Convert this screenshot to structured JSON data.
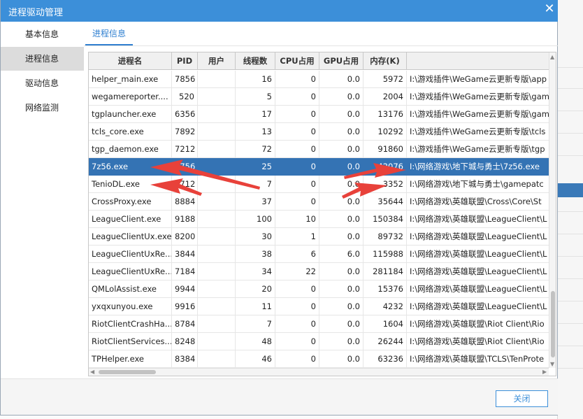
{
  "window": {
    "title": "进程驱动管理",
    "close_glyph": "✕"
  },
  "sidebar": {
    "items": [
      {
        "label": "基本信息",
        "active": false
      },
      {
        "label": "进程信息",
        "active": true
      },
      {
        "label": "驱动信息",
        "active": false
      },
      {
        "label": "网络监测",
        "active": false
      }
    ]
  },
  "tabs": [
    {
      "label": "进程信息"
    }
  ],
  "table": {
    "columns": [
      "进程名",
      "PID",
      "用户",
      "线程数",
      "CPU占用",
      "GPU占用",
      "内存(K)",
      ""
    ],
    "rows": [
      {
        "name": "helper_main.exe",
        "pid": "7856",
        "user": "",
        "threads": "16",
        "cpu": "0",
        "gpu": "0.0",
        "mem": "5972",
        "path": "I:\\游戏插件\\WeGame云更新专版\\app",
        "selected": false
      },
      {
        "name": "wegamereporter....",
        "pid": "520",
        "user": "",
        "threads": "5",
        "cpu": "0",
        "gpu": "0.0",
        "mem": "2004",
        "path": "I:\\游戏插件\\WeGame云更新专版\\gam",
        "selected": false
      },
      {
        "name": "tgplauncher.exe",
        "pid": "6356",
        "user": "",
        "threads": "17",
        "cpu": "0",
        "gpu": "0.0",
        "mem": "13176",
        "path": "I:\\游戏插件\\WeGame云更新专版\\gam",
        "selected": false
      },
      {
        "name": "tcls_core.exe",
        "pid": "7892",
        "user": "",
        "threads": "13",
        "cpu": "0",
        "gpu": "0.0",
        "mem": "10292",
        "path": "I:\\游戏插件\\WeGame云更新专版\\tcls",
        "selected": false
      },
      {
        "name": "tgp_daemon.exe",
        "pid": "7212",
        "user": "",
        "threads": "72",
        "cpu": "0",
        "gpu": "0.0",
        "mem": "91860",
        "path": "I:\\游戏插件\\WeGame云更新专版\\tgp",
        "selected": false
      },
      {
        "name": "7z56.exe",
        "pid": "1756",
        "user": "",
        "threads": "25",
        "cpu": "0",
        "gpu": "0.0",
        "mem": "42076",
        "path": "I:\\网络游戏\\地下城与勇士\\7z56.exe",
        "selected": true
      },
      {
        "name": "TenioDL.exe",
        "pid": "2712",
        "user": "",
        "threads": "7",
        "cpu": "0",
        "gpu": "0.0",
        "mem": "3352",
        "path": "I:\\网络游戏\\地下城与勇士\\gamepatc",
        "selected": false
      },
      {
        "name": "CrossProxy.exe",
        "pid": "8884",
        "user": "",
        "threads": "37",
        "cpu": "0",
        "gpu": "0.0",
        "mem": "35644",
        "path": "I:\\网络游戏\\英雄联盟\\Cross\\Core\\St",
        "selected": false
      },
      {
        "name": "LeagueClient.exe",
        "pid": "9188",
        "user": "",
        "threads": "100",
        "cpu": "10",
        "gpu": "0.0",
        "mem": "150384",
        "path": "I:\\网络游戏\\英雄联盟\\LeagueClient\\L",
        "selected": false
      },
      {
        "name": "LeagueClientUx.exe",
        "pid": "8200",
        "user": "",
        "threads": "30",
        "cpu": "1",
        "gpu": "0.0",
        "mem": "89732",
        "path": "I:\\网络游戏\\英雄联盟\\LeagueClient\\L",
        "selected": false
      },
      {
        "name": "LeagueClientUxRe...",
        "pid": "3844",
        "user": "",
        "threads": "38",
        "cpu": "6",
        "gpu": "6.0",
        "mem": "115988",
        "path": "I:\\网络游戏\\英雄联盟\\LeagueClient\\L",
        "selected": false
      },
      {
        "name": "LeagueClientUxRe...",
        "pid": "7184",
        "user": "",
        "threads": "34",
        "cpu": "22",
        "gpu": "0.0",
        "mem": "281184",
        "path": "I:\\网络游戏\\英雄联盟\\LeagueClient\\L",
        "selected": false
      },
      {
        "name": "QMLolAssist.exe",
        "pid": "9944",
        "user": "",
        "threads": "20",
        "cpu": "0",
        "gpu": "0.0",
        "mem": "15376",
        "path": "I:\\网络游戏\\英雄联盟\\LeagueClient\\L",
        "selected": false
      },
      {
        "name": "yxqxunyou.exe",
        "pid": "9916",
        "user": "",
        "threads": "11",
        "cpu": "0",
        "gpu": "0.0",
        "mem": "4232",
        "path": "I:\\网络游戏\\英雄联盟\\LeagueClient\\L",
        "selected": false
      },
      {
        "name": "RiotClientCrashHa...",
        "pid": "8784",
        "user": "",
        "threads": "7",
        "cpu": "0",
        "gpu": "0.0",
        "mem": "1604",
        "path": "I:\\网络游戏\\英雄联盟\\Riot Client\\Rio",
        "selected": false
      },
      {
        "name": "RiotClientServices....",
        "pid": "8248",
        "user": "",
        "threads": "48",
        "cpu": "0",
        "gpu": "0.0",
        "mem": "26244",
        "path": "I:\\网络游戏\\英雄联盟\\Riot Client\\Rio",
        "selected": false
      },
      {
        "name": "TPHelper.exe",
        "pid": "8384",
        "user": "",
        "threads": "46",
        "cpu": "0",
        "gpu": "0.0",
        "mem": "63236",
        "path": "I:\\网络游戏\\英雄联盟\\TCLS\\TenProte",
        "selected": false
      }
    ]
  },
  "footer": {
    "close_label": "关闭"
  },
  "colors": {
    "titlebar": "#3c8fd9",
    "selection": "#3473b4",
    "annotation_arrow": "#e8413a"
  }
}
